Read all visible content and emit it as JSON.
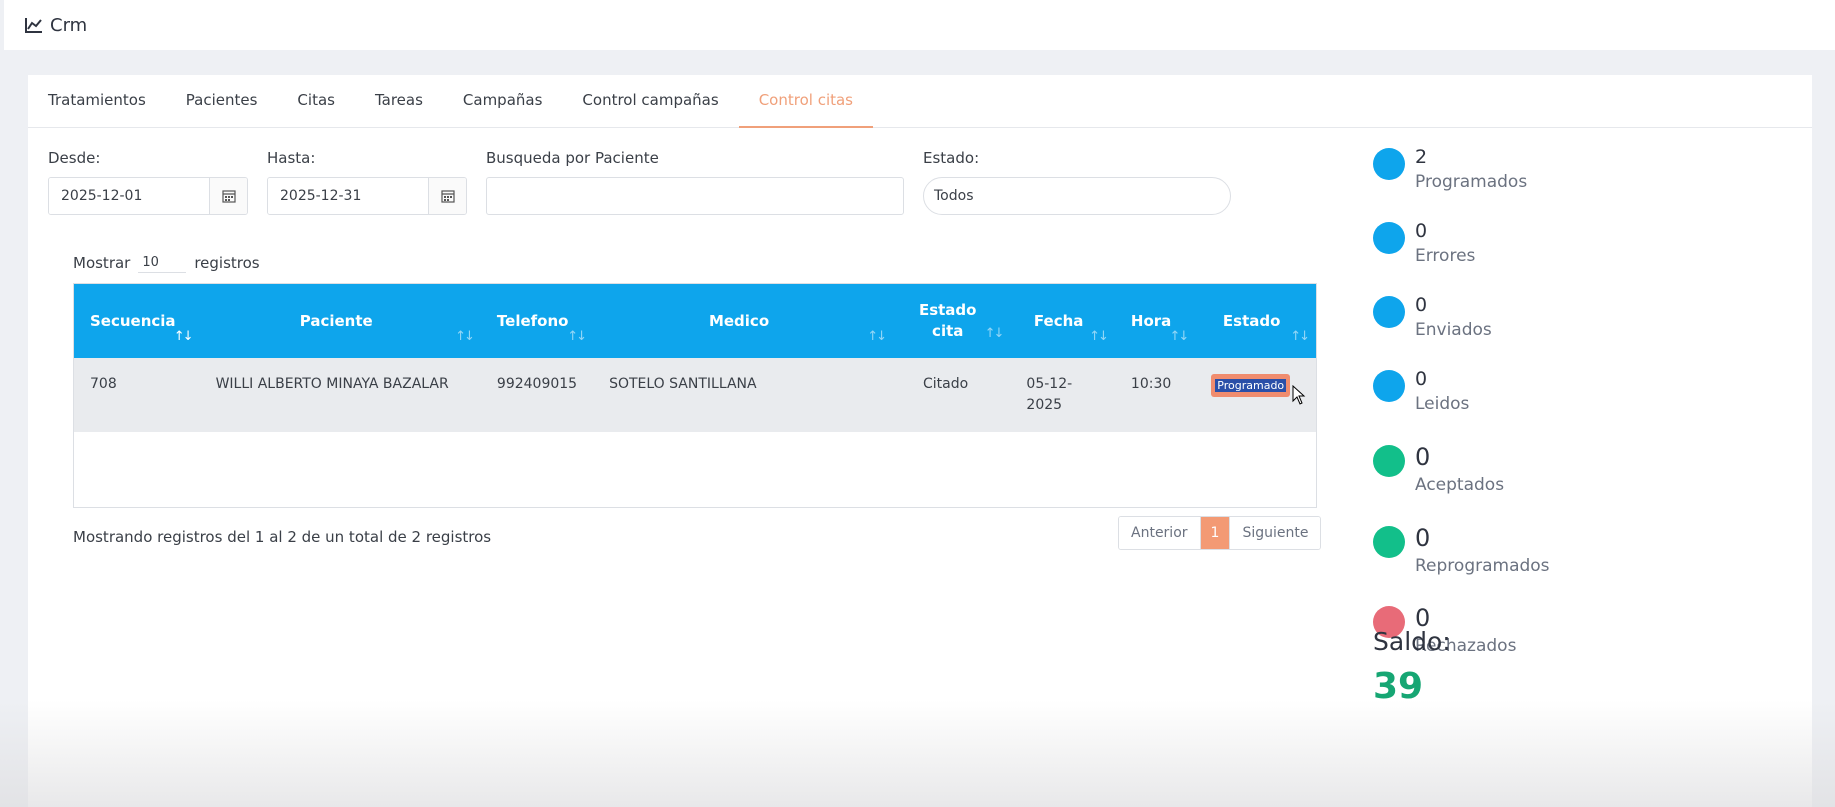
{
  "app": {
    "title": "Crm"
  },
  "tabs": [
    {
      "label": "Tratamientos"
    },
    {
      "label": "Pacientes"
    },
    {
      "label": "Citas"
    },
    {
      "label": "Tareas"
    },
    {
      "label": "Campañas"
    },
    {
      "label": "Control campañas"
    },
    {
      "label": "Control citas",
      "active": true
    }
  ],
  "filters": {
    "desde_label": "Desde:",
    "desde_value": "2025-12-01",
    "hasta_label": "Hasta:",
    "hasta_value": "2025-12-31",
    "paciente_label": "Busqueda por Paciente",
    "paciente_value": "",
    "estado_label": "Estado:",
    "estado_value": "Todos"
  },
  "table": {
    "show_prefix": "Mostrar",
    "page_length": "10",
    "show_suffix": "registros",
    "columns": {
      "secuencia": "Secuencia",
      "paciente": "Paciente",
      "telefono": "Telefono",
      "medico": "Medico",
      "estado_cita": "Estado cita",
      "fecha": "Fecha",
      "hora": "Hora",
      "estado": "Estado"
    },
    "rows": [
      {
        "secuencia": "708",
        "paciente": "WILLI ALBERTO MINAYA BAZALAR",
        "telefono": "992409015",
        "medico": "SOTELO SANTILLANA",
        "estado_cita": "Citado",
        "fecha": "05-12-2025",
        "hora": "10:30",
        "estado": "Programado"
      }
    ],
    "info": "Mostrando registros del 1 al 2 de un total de 2 registros",
    "pager": {
      "prev": "Anterior",
      "current": "1",
      "next": "Siguiente"
    }
  },
  "stats": [
    {
      "count": "2",
      "label": "Programados",
      "color": "#0ea5ec"
    },
    {
      "count": "0",
      "label": "Errores",
      "color": "#0ea5ec"
    },
    {
      "count": "0",
      "label": "Enviados",
      "color": "#0ea5ec"
    },
    {
      "count": "0",
      "label": "Leidos",
      "color": "#0ea5ec"
    },
    {
      "count": "0",
      "label": "Aceptados",
      "color": "#12bf8a"
    },
    {
      "count": "0",
      "label": "Reprogramados",
      "color": "#12bf8a"
    },
    {
      "count": "0",
      "label": "Rechazados",
      "color": "#e86b78"
    }
  ],
  "saldo": {
    "label": "Saldo:",
    "value": "39"
  },
  "colors": {
    "accent": "#0ea5ec",
    "active_tab": "#f0a07a",
    "saldo": "#16a673"
  }
}
